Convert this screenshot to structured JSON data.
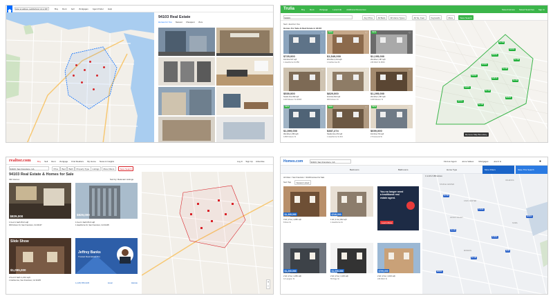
{
  "zillow": {
    "search_placeholder": "Enter an address, neighborhood, city or ZIP",
    "nav_items": [
      "Buy",
      "Rent",
      "Sell",
      "Mortgages",
      "Agent finder",
      "Help"
    ],
    "title": "94103 Real Estate",
    "tabs": [
      "Homes for You",
      "Newest",
      "Cheapest",
      "More"
    ],
    "colors": {
      "brand": "#006aff",
      "map_water": "#a9cdf0",
      "map_land": "#f2efe9"
    }
  },
  "trulia": {
    "logo": "Trulia",
    "nav_items": [
      "Buy",
      "Rent",
      "Mortgage",
      "Local Info",
      "Additional Resources"
    ],
    "right_links": [
      "Saved Homes",
      "Saved Searches",
      "Sign In"
    ],
    "search_value": "94103",
    "filters": [
      "Any Price",
      "All Beds",
      "All Home Types",
      "All Sq. Feet",
      "Keywords",
      "More"
    ],
    "save_button": "Save Search",
    "results_title": "Homes For Sale & Real Estate in 94103",
    "sort_label": "Sort: Just For You",
    "listings": [
      {
        "price": "$725,000",
        "details": "1bd  1ba  617 sqft",
        "address": "1 Hawthorne St #5D",
        "badge": ""
      },
      {
        "price": "$1,549,000",
        "details": "2bd  2ba  1,214 sqft",
        "address": "1 Fairfax Ave #1",
        "badge": "NEW"
      },
      {
        "price": "$1,195,000",
        "details": "2bd  2ba  1,187 sqft",
        "address": "246 Ritch St #604",
        "badge": "NEW"
      },
      {
        "price": "$539,000",
        "details": "Studio  1ba  390 sqft",
        "address": "1160 Mission St #2005",
        "badge": ""
      },
      {
        "price": "$829,000",
        "details": "1bd  1ba  813 sqft",
        "address": "960 Folsom St",
        "badge": ""
      },
      {
        "price": "$1,295,000",
        "details": "2bd  2ba  1,357 sqft",
        "address": "1169 Mission St",
        "badge": ""
      },
      {
        "price": "$1,599,000",
        "details": "3bd  2ba  1,650 sqft",
        "address": "1268 Folsom St",
        "badge": "NEW"
      },
      {
        "price": "$387,274",
        "details": "Studio  1ba  472 sqft",
        "address": "1 Hawthorne St #21",
        "badge": "NEW"
      },
      {
        "price": "$699,000",
        "details": "1bd  1ba  724 sqft",
        "address": "2 Townsend St",
        "badge": "NEW"
      }
    ],
    "map_pins": [
      "$1.5M",
      "$699K",
      "$829K",
      "$1.3M",
      "$725K",
      "$1.2M",
      "$539K",
      "$387K",
      "$1.6M",
      "$998K",
      "$2.3M",
      "$899K",
      "$1.1M",
      "$650K"
    ],
    "map_footer": "Remove Map Boundary",
    "colors": {
      "brand": "#3bb54a"
    }
  },
  "realtor": {
    "logo": "realtor.com",
    "nav_items": [
      "Buy",
      "Sell",
      "Rent",
      "Mortgage",
      "Find Realtors",
      "My Home",
      "News & Insights"
    ],
    "right_links": [
      "Log In",
      "Sign Up",
      "Advertise"
    ],
    "search_value": "94103, San Francisco, CA",
    "filters": [
      "Price",
      "Bed",
      "Bath",
      "Property Type",
      "Listings",
      "More Filters"
    ],
    "save_button": "Save Search",
    "title": "94103 Real Estate & Homes for Sale",
    "count": "322 Homes",
    "sort_label": "Sort by: Relevant Listings",
    "cards": [
      {
        "price": "$829,000",
        "details": "1 bed  1 bath  813 sqft",
        "address": "960 Folsom St, San Francisco, CA 94107"
      },
      {
        "price": "$829,000",
        "details": "1 bed  1 bath  813 sqft",
        "address": "1 Hawthorne St, San Francisco, CA 94105"
      },
      {
        "price": "$1,095,000",
        "details": "2 bed  2 bath  1,214 sqft",
        "address": "1 Fairfax Ave, San Francisco, CA 94105"
      }
    ],
    "slideshow_label": "Slide Show",
    "ad_name": "Jeffrey Banks",
    "ad_sub": "Trusted Real Estate Pro",
    "bottom_actions": [
      "1-(415) 555-0135",
      "Email",
      "Website"
    ],
    "colors": {
      "brand": "#d92228"
    }
  },
  "homes": {
    "logo": "Homes.com",
    "search_value": "94103, San Francisco, CA",
    "top_links": [
      "Find an Agent",
      "Home Values",
      "Mortgages",
      "How It Is"
    ],
    "filters": [
      "Bedrooms",
      "Bathrooms",
      "Home Type",
      "More Filters",
      "Save This Search"
    ],
    "breadcrumb": "All Cities > San Francisco > 94103 Homes For Sale",
    "sort_label": "Sort Top",
    "sort_value": "Newest Listed",
    "results_label": "1 to 18 of 180 Homes",
    "listings": [
      {
        "price": "$1,395,000",
        "details": "3 bd | 2 ba | 1,680 sqft",
        "address": "8 Dore St"
      },
      {
        "price": "$749,000",
        "details": "1 bd | 1 ba | 812 sqft",
        "address": "1 Hawthorne St"
      },
      {
        "price": "$1,200,000",
        "details": "2 bd | 2 ba | 1,250 sqft",
        "address": "12 Langton St"
      },
      {
        "price": "$1,095,000",
        "details": "2 bd | 2 ba | 1,133 sqft",
        "address": "55 Page St"
      },
      {
        "price": "$799,000",
        "details": "2 bd | 2 ba | 1,023 sqft",
        "address": "246 Ritch St"
      }
    ],
    "ad_text": "You no longer need a traditional real estate agent.",
    "ad_button": "Learn More",
    "map_labels": [
      "VALENCIA",
      "STAPLE CENTER",
      "CIVIC CENTER",
      "HAYES VALLEY",
      "MISSION",
      "SOMA"
    ],
    "map_pins": [
      "$1.5M",
      "$749K",
      "$1.2M",
      "$799K",
      "$1.1M",
      "$2M",
      "$899K",
      "$680K"
    ],
    "colors": {
      "brand": "#1a64c8",
      "accent": "#f58220"
    }
  }
}
